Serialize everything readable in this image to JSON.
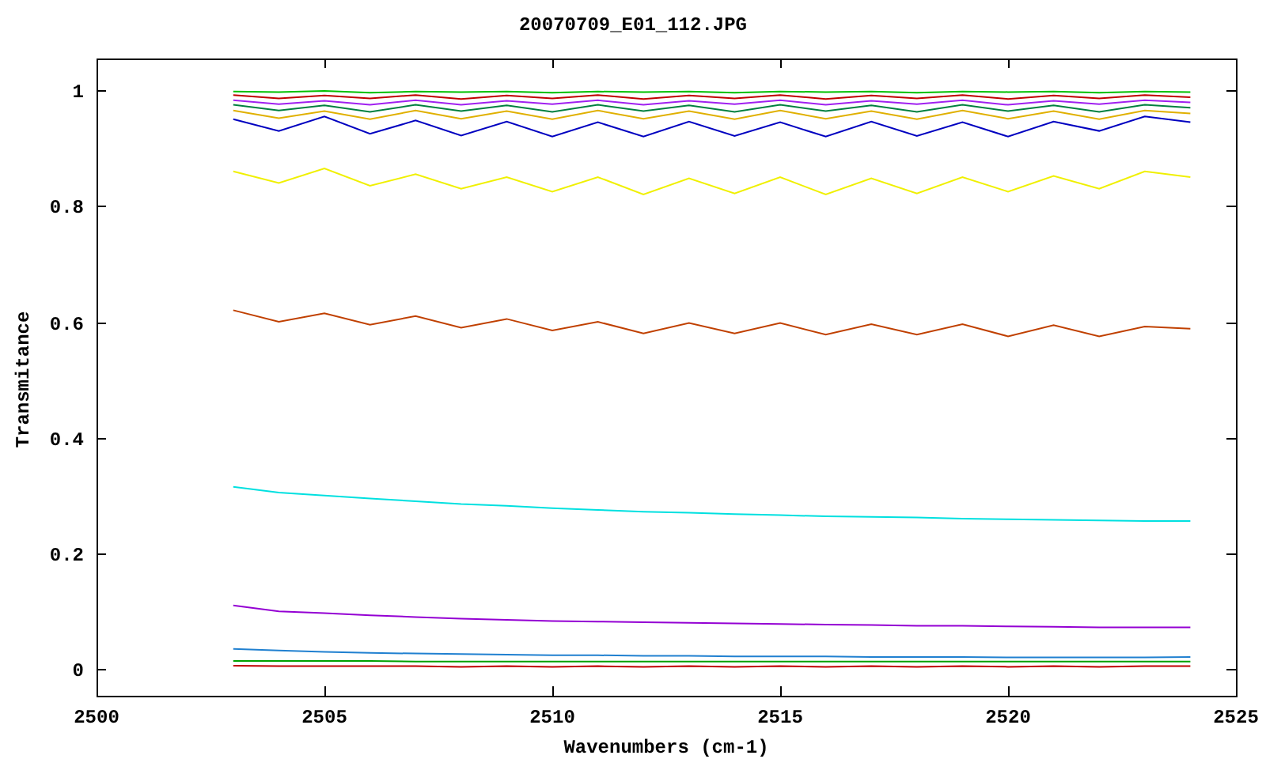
{
  "chart_data": {
    "type": "line",
    "title": "20070709_E01_112.JPG",
    "xlabel": "Wavenumbers (cm-1)",
    "ylabel": "Transmitance",
    "xlim": [
      2500,
      2525
    ],
    "ylim": [
      -0.046,
      1.055
    ],
    "xticks": [
      2500,
      2505,
      2510,
      2515,
      2520,
      2525
    ],
    "yticks": [
      {
        "value": 0,
        "label": "0"
      },
      {
        "value": 0.2,
        "label": "0.2"
      },
      {
        "value": 0.4,
        "label": "0.4"
      },
      {
        "value": 0.6,
        "label": "0.6"
      },
      {
        "value": 0.8,
        "label": "0.8"
      },
      {
        "value": 1,
        "label": "1"
      }
    ],
    "x": [
      2503,
      2504,
      2505,
      2506,
      2507,
      2508,
      2509,
      2510,
      2511,
      2512,
      2513,
      2514,
      2515,
      2516,
      2517,
      2518,
      2519,
      2520,
      2521,
      2522,
      2523,
      2524
    ],
    "series": [
      {
        "color": "#00c000",
        "values": [
          0.998,
          0.997,
          0.999,
          0.996,
          0.998,
          0.997,
          0.998,
          0.996,
          0.998,
          0.997,
          0.998,
          0.996,
          0.998,
          0.997,
          0.998,
          0.996,
          0.998,
          0.997,
          0.998,
          0.996,
          0.998,
          0.997
        ]
      },
      {
        "color": "#c00000",
        "values": [
          0.992,
          0.986,
          0.991,
          0.986,
          0.992,
          0.985,
          0.991,
          0.986,
          0.992,
          0.985,
          0.991,
          0.986,
          0.992,
          0.985,
          0.991,
          0.986,
          0.992,
          0.985,
          0.991,
          0.986,
          0.992,
          0.988
        ]
      },
      {
        "color": "#a020f0",
        "values": [
          0.983,
          0.976,
          0.982,
          0.975,
          0.983,
          0.975,
          0.982,
          0.976,
          0.983,
          0.975,
          0.982,
          0.976,
          0.983,
          0.975,
          0.982,
          0.976,
          0.983,
          0.975,
          0.982,
          0.976,
          0.983,
          0.979
        ]
      },
      {
        "color": "#008040",
        "values": [
          0.975,
          0.965,
          0.974,
          0.963,
          0.975,
          0.964,
          0.974,
          0.963,
          0.975,
          0.964,
          0.974,
          0.963,
          0.975,
          0.964,
          0.974,
          0.963,
          0.975,
          0.964,
          0.974,
          0.963,
          0.975,
          0.97
        ]
      },
      {
        "color": "#e0b000",
        "values": [
          0.965,
          0.952,
          0.964,
          0.95,
          0.965,
          0.951,
          0.964,
          0.95,
          0.965,
          0.951,
          0.964,
          0.95,
          0.965,
          0.951,
          0.964,
          0.95,
          0.965,
          0.951,
          0.964,
          0.95,
          0.965,
          0.96
        ]
      },
      {
        "color": "#0000c0",
        "values": [
          0.95,
          0.93,
          0.955,
          0.925,
          0.948,
          0.922,
          0.946,
          0.92,
          0.945,
          0.92,
          0.946,
          0.921,
          0.945,
          0.92,
          0.946,
          0.921,
          0.945,
          0.92,
          0.946,
          0.93,
          0.955,
          0.945
        ]
      },
      {
        "color": "#f0f000",
        "values": [
          0.86,
          0.84,
          0.865,
          0.835,
          0.855,
          0.83,
          0.85,
          0.825,
          0.85,
          0.82,
          0.848,
          0.822,
          0.85,
          0.82,
          0.848,
          0.822,
          0.85,
          0.825,
          0.852,
          0.83,
          0.86,
          0.85
        ]
      },
      {
        "color": "#c04000",
        "values": [
          0.62,
          0.6,
          0.615,
          0.595,
          0.61,
          0.59,
          0.605,
          0.585,
          0.6,
          0.58,
          0.598,
          0.58,
          0.598,
          0.578,
          0.596,
          0.578,
          0.596,
          0.575,
          0.594,
          0.575,
          0.592,
          0.588
        ]
      },
      {
        "color": "#00e0e0",
        "values": [
          0.315,
          0.305,
          0.3,
          0.295,
          0.29,
          0.285,
          0.282,
          0.278,
          0.275,
          0.272,
          0.27,
          0.268,
          0.266,
          0.264,
          0.263,
          0.262,
          0.26,
          0.259,
          0.258,
          0.257,
          0.256,
          0.256
        ]
      },
      {
        "color": "#9400d3",
        "values": [
          0.11,
          0.1,
          0.097,
          0.093,
          0.09,
          0.087,
          0.085,
          0.083,
          0.082,
          0.081,
          0.08,
          0.079,
          0.078,
          0.077,
          0.076,
          0.075,
          0.075,
          0.074,
          0.073,
          0.072,
          0.072,
          0.072
        ]
      },
      {
        "color": "#2080d0",
        "values": [
          0.035,
          0.032,
          0.03,
          0.028,
          0.027,
          0.026,
          0.025,
          0.024,
          0.024,
          0.023,
          0.023,
          0.022,
          0.022,
          0.022,
          0.021,
          0.021,
          0.021,
          0.02,
          0.02,
          0.02,
          0.02,
          0.021
        ]
      },
      {
        "color": "#00a000",
        "values": [
          0.014,
          0.014,
          0.014,
          0.014,
          0.013,
          0.013,
          0.013,
          0.013,
          0.013,
          0.013,
          0.013,
          0.013,
          0.013,
          0.013,
          0.013,
          0.013,
          0.013,
          0.013,
          0.013,
          0.013,
          0.013,
          0.013
        ]
      },
      {
        "color": "#c00000",
        "values": [
          0.006,
          0.005,
          0.005,
          0.005,
          0.005,
          0.004,
          0.005,
          0.004,
          0.005,
          0.004,
          0.005,
          0.004,
          0.005,
          0.004,
          0.005,
          0.004,
          0.005,
          0.004,
          0.005,
          0.004,
          0.005,
          0.005
        ]
      }
    ]
  }
}
